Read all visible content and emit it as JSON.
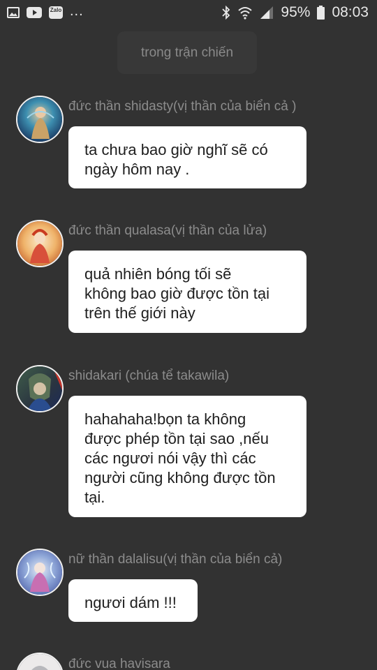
{
  "status_bar": {
    "left_icons": [
      "gallery-icon",
      "youtube-icon",
      "zalo-icon"
    ],
    "zalo_label": "Zalo",
    "more": "...",
    "battery": "95%",
    "time": "08:03"
  },
  "scene": {
    "label": "trong trận chiến"
  },
  "messages": [
    {
      "sender": "đức thần shidasty(vị thần của biển cả )",
      "text": "ta chưa bao giờ nghĩ sẽ có\nngày hôm nay ."
    },
    {
      "sender": "đức thần qualasa(vị thần của lửa)",
      "text": "quả nhiên bóng tối sẽ\nkhông bao giờ được tồn tại\ntrên thế giới này"
    },
    {
      "sender": "shidakari (chúa tể takawila)",
      "text": "hahahaha!bọn ta không\nđược phép tồn tại sao ,nếu\ncác ngươi nói vậy thì các\nngười cũng không được tồn\ntại."
    },
    {
      "sender": "nữ thần dalalisu(vị thần của biển cả)",
      "text": "ngươi dám !!!"
    },
    {
      "sender": "đức vua havisara",
      "text": ""
    }
  ]
}
